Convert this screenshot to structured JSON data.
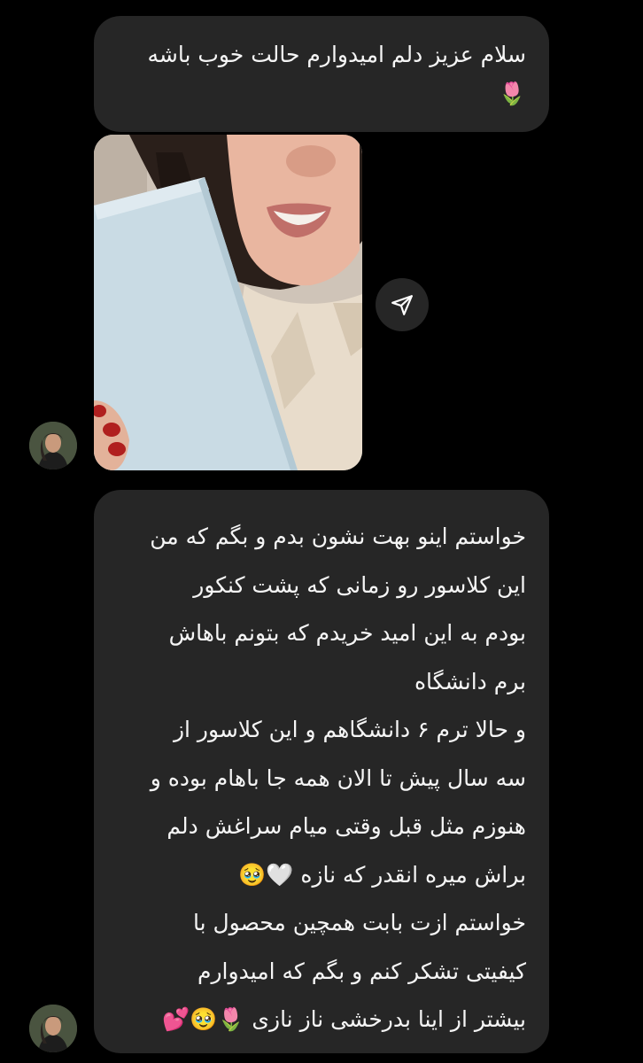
{
  "thread": {
    "message_1": {
      "lines": [
        "سلام عزیز دلم امیدوارم حالت خوب باشه",
        "🌷"
      ]
    },
    "message_2": {
      "lines": [
        "خواستم اینو بهت نشون بدم و بگم که من",
        "این کلاسور رو زمانی که پشت کنکور",
        "بودم به این امید خریدم که بتونم باهاش",
        "برم دانشگاه",
        "و حالا ترم ۶ دانشگاهم و این کلاسور از",
        "سه سال پیش تا الان همه جا باهام بوده و",
        "هنوزم مثل قبل وقتی میام سراغش دلم",
        "براش میره انقدر که نازه 🤍🥹",
        "خواستم ازت بابت همچین محصول با",
        "کیفیتی تشکر کنم و بگم که امیدوارم",
        "بیشتر از اینا بدرخشی ناز نازی 🌷🥹💕"
      ]
    }
  },
  "icons": {
    "share": "share-arrow-icon",
    "avatar": "user-avatar"
  },
  "colors": {
    "background": "#000000",
    "bubble": "#262626",
    "text": "#f5f5f5"
  }
}
